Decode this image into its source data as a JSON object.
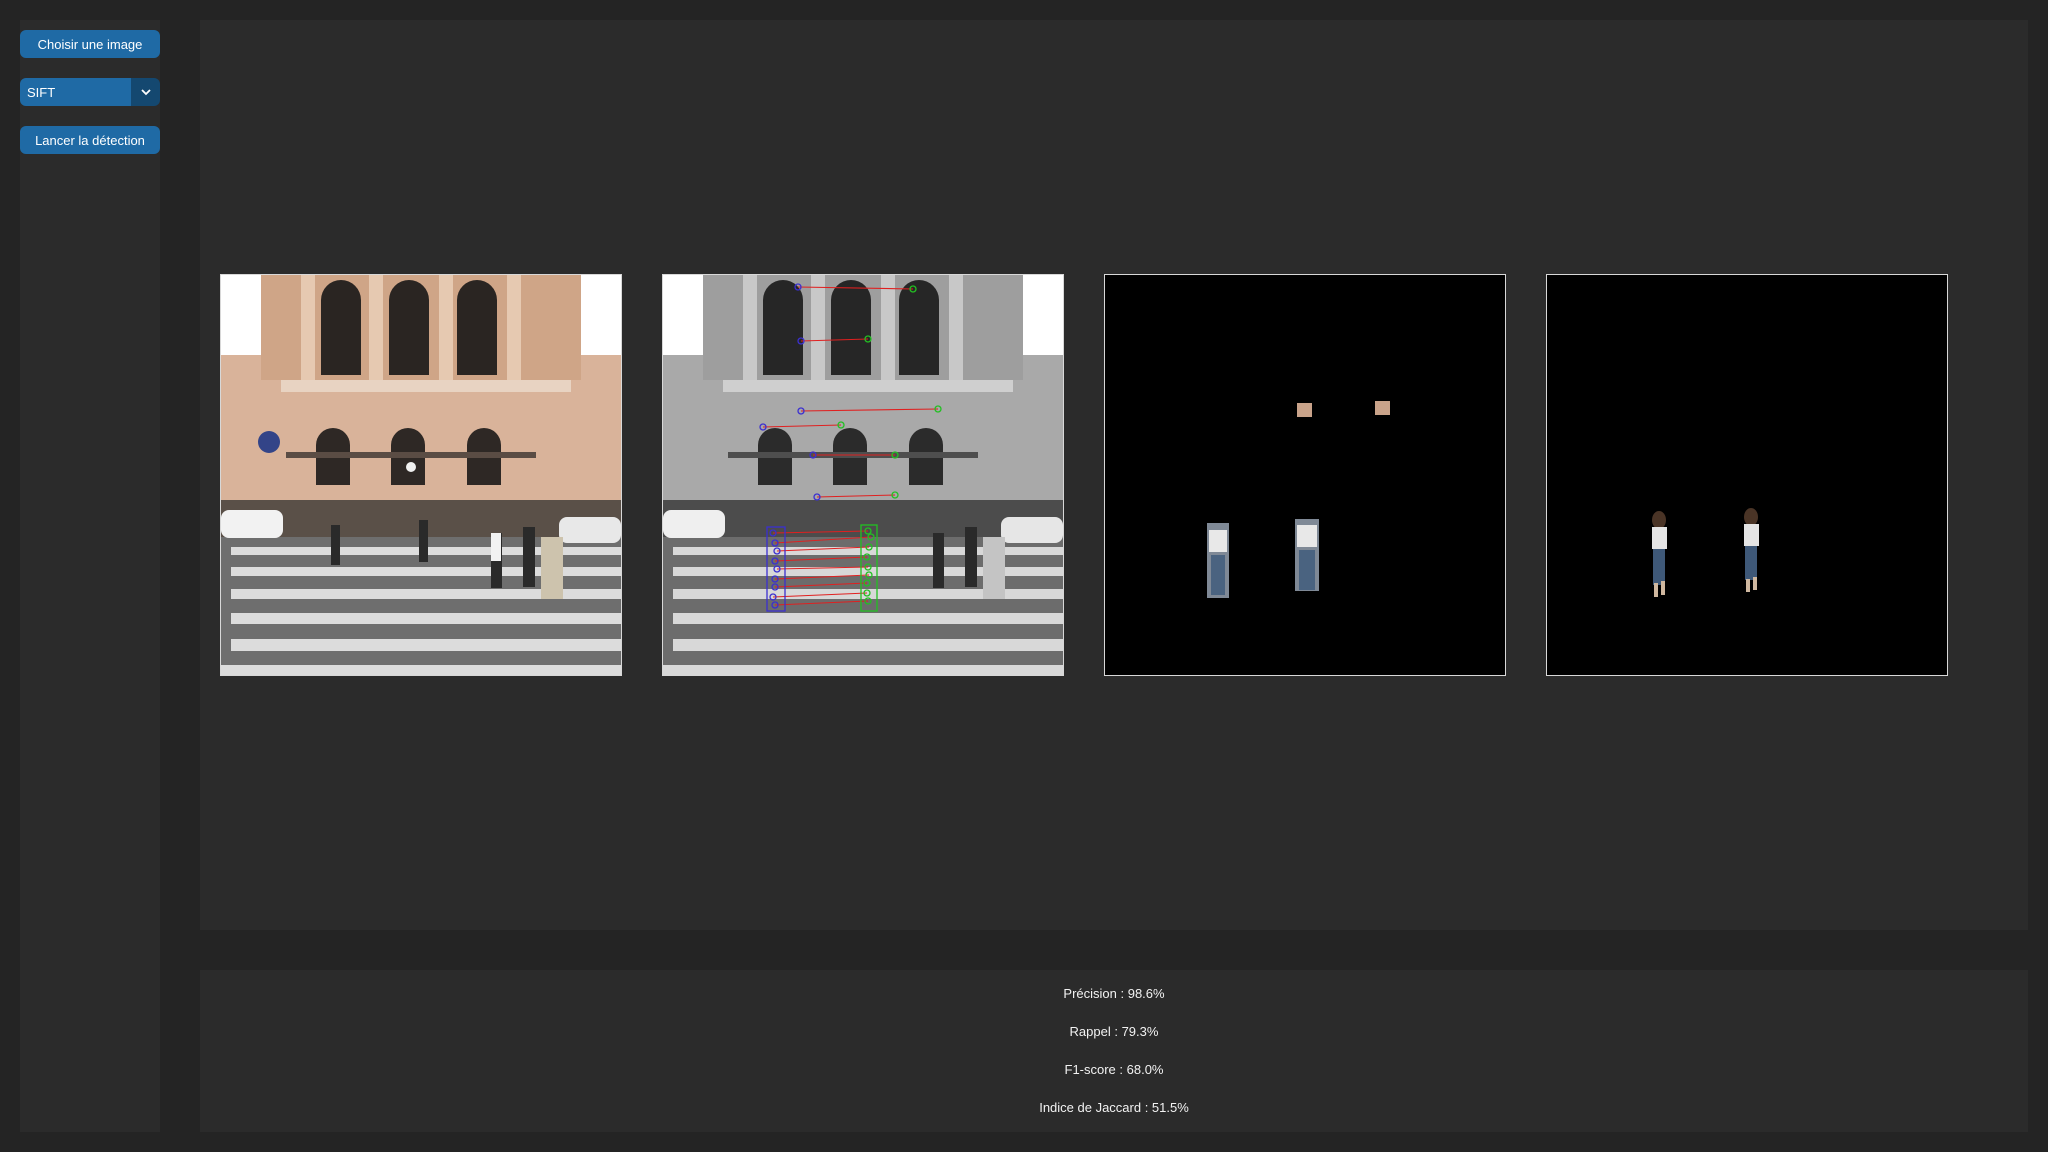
{
  "sidebar": {
    "choose_image_label": "Choisir une image",
    "detector": {
      "selected": "SIFT",
      "icon": "chevron-down-icon"
    },
    "run_label": "Lancer la détection"
  },
  "panels": [
    {
      "id": "original",
      "description_icon": "image"
    },
    {
      "id": "keypoint-matches",
      "description_icon": "image"
    },
    {
      "id": "detected-regions",
      "description_icon": "image"
    },
    {
      "id": "ground-truth-mask",
      "description_icon": "image"
    }
  ],
  "metrics": {
    "precision": "Précision : 98.6%",
    "recall": "Rappel : 79.3%",
    "f1": "F1-score : 68.0%",
    "jaccard": "Indice de Jaccard : 51.5%"
  },
  "colors": {
    "background": "#242424",
    "panel": "#2b2b2b",
    "button": "#1f6aa5",
    "button_dark": "#144870",
    "match_line": "#e02020",
    "keypoint_source": "#3b2fd0",
    "keypoint_target": "#22c022"
  }
}
